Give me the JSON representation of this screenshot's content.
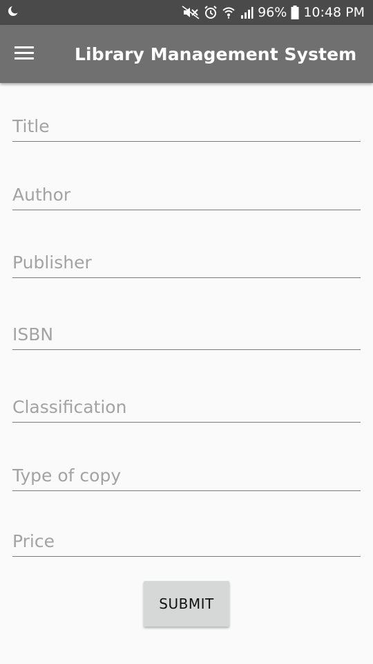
{
  "status_bar": {
    "battery_percent": "96%",
    "time": "10:48 PM",
    "icons": [
      "moon-icon",
      "mute-icon",
      "alarm-icon",
      "wifi-icon",
      "signal-icon",
      "battery-icon"
    ]
  },
  "app_bar": {
    "title": "Library Management System",
    "menu_icon": "hamburger-menu-icon"
  },
  "form": {
    "fields": [
      {
        "placeholder": "Title",
        "value": ""
      },
      {
        "placeholder": "Author",
        "value": ""
      },
      {
        "placeholder": "Publisher",
        "value": ""
      },
      {
        "placeholder": "ISBN",
        "value": ""
      },
      {
        "placeholder": "Classification",
        "value": ""
      },
      {
        "placeholder": "Type of copy",
        "value": ""
      },
      {
        "placeholder": "Price",
        "value": ""
      }
    ],
    "submit_label": "SUBMIT"
  },
  "colors": {
    "status_bar_bg": "#4a4a4a",
    "app_bar_bg": "#707070",
    "page_bg": "#fafafa",
    "button_bg": "#d6d7d7"
  }
}
